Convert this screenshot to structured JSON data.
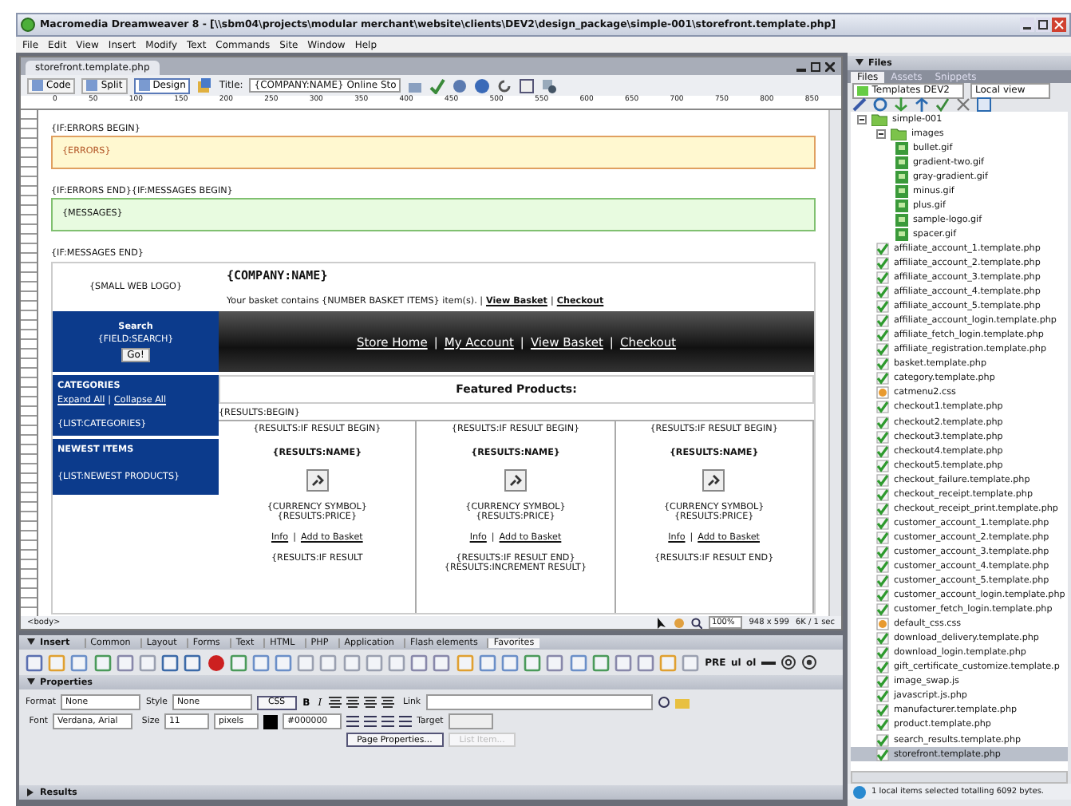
{
  "window": {
    "title": "Macromedia Dreamweaver 8 - [\\\\sbm04\\projects\\modular merchant\\website\\clients\\DEV2\\design_package\\simple-001\\storefront.template.php]"
  },
  "menu": [
    "File",
    "Edit",
    "View",
    "Insert",
    "Modify",
    "Text",
    "Commands",
    "Site",
    "Window",
    "Help"
  ],
  "document": {
    "tab": "storefront.template.php",
    "view_buttons": [
      {
        "label": "Code",
        "selected": false
      },
      {
        "label": "Split",
        "selected": false
      },
      {
        "label": "Design",
        "selected": true
      }
    ],
    "title_label": "Title:",
    "title_value": "{COMPANY:NAME} Online Sto",
    "ruler_ticks": [
      "0",
      "50",
      "100",
      "150",
      "200",
      "250",
      "300",
      "350",
      "400",
      "450",
      "500",
      "550",
      "600",
      "650",
      "700",
      "750",
      "800",
      "850"
    ],
    "status": {
      "tag": "<body>",
      "zoom": "100%",
      "size": "948 x 599",
      "weight": "6K / 1 sec"
    }
  },
  "page": {
    "errors_begin": "{IF:ERRORS BEGIN}",
    "errors": "{ERRORS}",
    "messages_begin": "{IF:ERRORS END}{IF:MESSAGES BEGIN}",
    "messages": "{MESSAGES}",
    "messages_end": "{IF:MESSAGES END}",
    "logo": "{SMALL WEB LOGO}",
    "company": "{COMPANY:NAME}",
    "basket_text": "Your basket contains {NUMBER BASKET ITEMS} item(s). |",
    "basket_links": [
      "View Basket",
      "Checkout"
    ],
    "basket_separator": "|",
    "search": {
      "title": "Search",
      "field": "{FIELD:SEARCH}",
      "button": "Go!"
    },
    "nav_links": [
      "Store Home",
      "My Account",
      "View Basket",
      "Checkout"
    ],
    "nav_separator": "|",
    "categories": {
      "title": "CATEGORIES",
      "links": [
        "Expand All",
        "Collapse All"
      ],
      "separator": "|",
      "list": "{LIST:CATEGORIES}"
    },
    "newest": {
      "title": "NEWEST ITEMS",
      "list": "{LIST:NEWEST PRODUCTS}"
    },
    "featured": "Featured Products:",
    "results_begin": "{RESULTS:BEGIN}",
    "products": [
      {
        "begin": "{RESULTS:IF RESULT BEGIN}",
        "name": "{RESULTS:NAME}",
        "price": "{CURRENCY SYMBOL}{RESULTS:PRICE}",
        "links": [
          "Info",
          "Add to Basket"
        ],
        "end": "{RESULTS:IF RESULT"
      },
      {
        "begin": "{RESULTS:IF RESULT BEGIN}",
        "name": "{RESULTS:NAME}",
        "price": "{CURRENCY SYMBOL}{RESULTS:PRICE}",
        "links": [
          "Info",
          "Add to Basket"
        ],
        "end": "{RESULTS:IF RESULT END}{RESULTS:INCREMENT RESULT}"
      },
      {
        "begin": "{RESULTS:IF RESULT BEGIN}",
        "name": "{RESULTS:NAME}",
        "price": "{CURRENCY SYMBOL}{RESULTS:PRICE}",
        "links": [
          "Info",
          "Add to Basket"
        ],
        "end": "{RESULTS:IF RESULT END}"
      }
    ]
  },
  "insert": {
    "title": "Insert",
    "tabs": [
      {
        "label": "Common",
        "selected": false
      },
      {
        "label": "Layout",
        "selected": false
      },
      {
        "label": "Forms",
        "selected": false
      },
      {
        "label": "Text",
        "selected": false
      },
      {
        "label": "HTML",
        "selected": false
      },
      {
        "label": "PHP",
        "selected": false
      },
      {
        "label": "Application",
        "selected": false
      },
      {
        "label": "Flash elements",
        "selected": false
      },
      {
        "label": "Favorites",
        "selected": true
      }
    ],
    "text_buttons": [
      "PRE",
      "ul",
      "ol"
    ]
  },
  "properties": {
    "title": "Properties",
    "format_label": "Format",
    "format": "None",
    "style_label": "Style",
    "style": "None",
    "css_button": "CSS",
    "bold": "B",
    "italic": "I",
    "link_label": "Link",
    "font_label": "Font",
    "font": "Verdana, Arial",
    "size_label": "Size",
    "size": "11",
    "unit": "pixels",
    "color": "#000000",
    "target_label": "Target",
    "buttons": [
      {
        "label": "Page Properties...",
        "disabled": false
      },
      {
        "label": "List Item...",
        "disabled": true
      }
    ]
  },
  "results": {
    "title": "Results"
  },
  "files": {
    "title": "Files",
    "tabs": [
      {
        "label": "Files",
        "selected": true
      },
      {
        "label": "Assets",
        "selected": false
      },
      {
        "label": "Snippets",
        "selected": false
      }
    ],
    "site": "Templates DEV2",
    "view": "Local view",
    "tree": [
      {
        "name": "simple-001",
        "kind": "folder",
        "expanded": true,
        "selected": false,
        "children": [
          {
            "name": "images",
            "kind": "folder",
            "expanded": true,
            "selected": false,
            "children": [
              {
                "name": "bullet.gif",
                "kind": "image",
                "selected": false
              },
              {
                "name": "gradient-two.gif",
                "kind": "image",
                "selected": false
              },
              {
                "name": "gray-gradient.gif",
                "kind": "image",
                "selected": false
              },
              {
                "name": "minus.gif",
                "kind": "image",
                "selected": false
              },
              {
                "name": "plus.gif",
                "kind": "image",
                "selected": false
              },
              {
                "name": "sample-logo.gif",
                "kind": "image",
                "selected": false
              },
              {
                "name": "spacer.gif",
                "kind": "image",
                "selected": false
              }
            ]
          },
          {
            "name": "affiliate_account_1.template.php",
            "kind": "template",
            "selected": false
          },
          {
            "name": "affiliate_account_2.template.php",
            "kind": "template",
            "selected": false
          },
          {
            "name": "affiliate_account_3.template.php",
            "kind": "template",
            "selected": false
          },
          {
            "name": "affiliate_account_4.template.php",
            "kind": "template",
            "selected": false
          },
          {
            "name": "affiliate_account_5.template.php",
            "kind": "template",
            "selected": false
          },
          {
            "name": "affiliate_account_login.template.php",
            "kind": "template",
            "selected": false
          },
          {
            "name": "affiliate_fetch_login.template.php",
            "kind": "template",
            "selected": false
          },
          {
            "name": "affiliate_registration.template.php",
            "kind": "template",
            "selected": false
          },
          {
            "name": "basket.template.php",
            "kind": "template",
            "selected": false
          },
          {
            "name": "category.template.php",
            "kind": "template",
            "selected": false
          },
          {
            "name": "catmenu2.css",
            "kind": "stylesheet",
            "selected": false
          },
          {
            "name": "checkout1.template.php",
            "kind": "template",
            "selected": false
          },
          {
            "name": "checkout2.template.php",
            "kind": "template",
            "selected": false
          },
          {
            "name": "checkout3.template.php",
            "kind": "template",
            "selected": false
          },
          {
            "name": "checkout4.template.php",
            "kind": "template",
            "selected": false
          },
          {
            "name": "checkout5.template.php",
            "kind": "template",
            "selected": false
          },
          {
            "name": "checkout_failure.template.php",
            "kind": "template",
            "selected": false
          },
          {
            "name": "checkout_receipt.template.php",
            "kind": "template",
            "selected": false
          },
          {
            "name": "checkout_receipt_print.template.php",
            "kind": "template",
            "selected": false
          },
          {
            "name": "customer_account_1.template.php",
            "kind": "template",
            "selected": false
          },
          {
            "name": "customer_account_2.template.php",
            "kind": "template",
            "selected": false
          },
          {
            "name": "customer_account_3.template.php",
            "kind": "template",
            "selected": false
          },
          {
            "name": "customer_account_4.template.php",
            "kind": "template",
            "selected": false
          },
          {
            "name": "customer_account_5.template.php",
            "kind": "template",
            "selected": false
          },
          {
            "name": "customer_account_login.template.php",
            "kind": "template",
            "selected": false
          },
          {
            "name": "customer_fetch_login.template.php",
            "kind": "template",
            "selected": false
          },
          {
            "name": "default_css.css",
            "kind": "stylesheet",
            "selected": false
          },
          {
            "name": "download_delivery.template.php",
            "kind": "template",
            "selected": false
          },
          {
            "name": "download_login.template.php",
            "kind": "template",
            "selected": false
          },
          {
            "name": "gift_certificate_customize.template.p",
            "kind": "template",
            "selected": false
          },
          {
            "name": "image_swap.js",
            "kind": "template",
            "selected": false
          },
          {
            "name": "javascript.js.php",
            "kind": "template",
            "selected": false
          },
          {
            "name": "manufacturer.template.php",
            "kind": "template",
            "selected": false
          },
          {
            "name": "product.template.php",
            "kind": "template",
            "selected": false
          },
          {
            "name": "search_results.template.php",
            "kind": "template",
            "selected": false
          },
          {
            "name": "storefront.template.php",
            "kind": "template",
            "selected": true
          }
        ]
      }
    ],
    "status": "1 local items selected totalling 6092 bytes."
  }
}
